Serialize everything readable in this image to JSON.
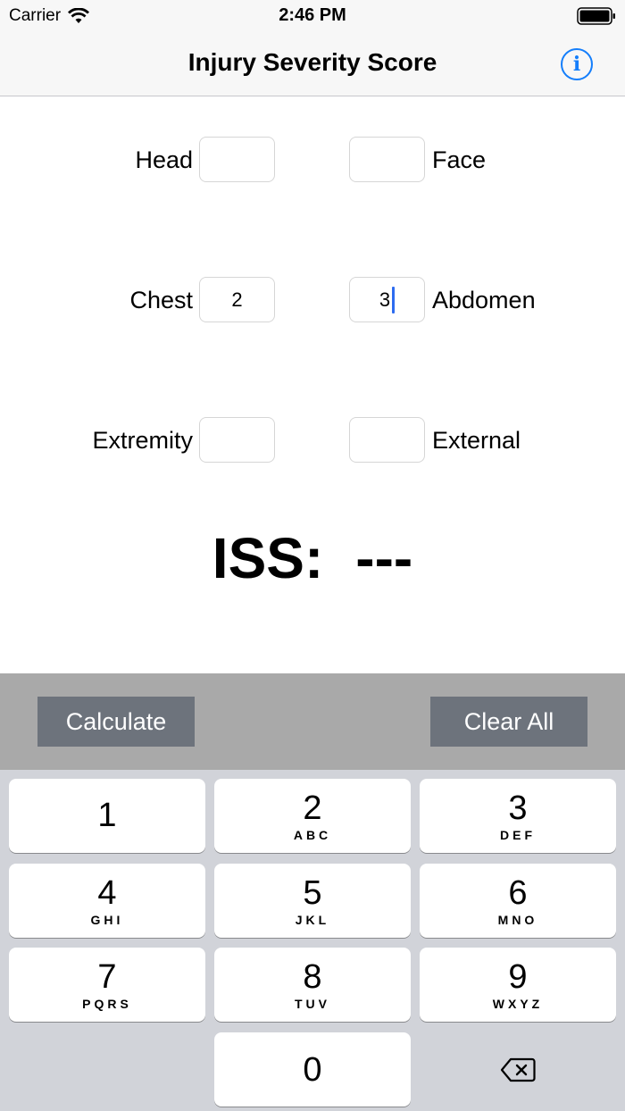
{
  "status_bar": {
    "carrier": "Carrier",
    "time": "2:46 PM",
    "icons": [
      "wifi-icon",
      "battery-icon"
    ]
  },
  "nav": {
    "title": "Injury Severity Score",
    "info_icon": "info-icon",
    "info_glyph": "i",
    "accent_color": "#147efb"
  },
  "fields": {
    "head": {
      "label": "Head",
      "value": ""
    },
    "face": {
      "label": "Face",
      "value": ""
    },
    "chest": {
      "label": "Chest",
      "value": "2"
    },
    "abdomen": {
      "label": "Abdomen",
      "value": "3"
    },
    "extremity": {
      "label": "Extremity",
      "value": ""
    },
    "external": {
      "label": "External",
      "value": ""
    }
  },
  "result": {
    "label": "ISS:",
    "value": "---"
  },
  "actions": {
    "calculate": "Calculate",
    "clear_all": "Clear All"
  },
  "keypad": {
    "keys": [
      {
        "digit": "1",
        "letters": ""
      },
      {
        "digit": "2",
        "letters": "ABC"
      },
      {
        "digit": "3",
        "letters": "DEF"
      },
      {
        "digit": "4",
        "letters": "GHI"
      },
      {
        "digit": "5",
        "letters": "JKL"
      },
      {
        "digit": "6",
        "letters": "MNO"
      },
      {
        "digit": "7",
        "letters": "PQRS"
      },
      {
        "digit": "8",
        "letters": "TUV"
      },
      {
        "digit": "9",
        "letters": "WXYZ"
      },
      {
        "digit": "0",
        "letters": ""
      }
    ],
    "delete_icon": "backspace-icon"
  }
}
